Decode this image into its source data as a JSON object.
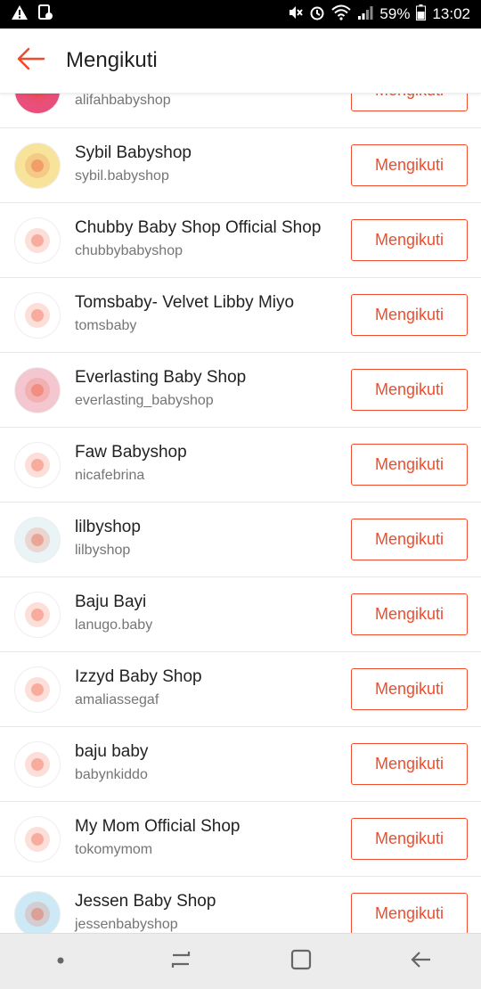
{
  "status_bar": {
    "battery": "59%",
    "time": "13:02",
    "icons": [
      "warning-icon",
      "screenshot-icon",
      "mute-icon",
      "alarm-icon",
      "wifi-icon",
      "signal-icon",
      "battery-icon"
    ]
  },
  "header": {
    "title": "Mengikuti",
    "back_icon": "arrow-left-icon"
  },
  "colors": {
    "accent": "#ee4d2d",
    "divider": "#e6e6e6",
    "subtext": "#757575"
  },
  "shops": [
    {
      "name": "",
      "username": "alifahbabyshop",
      "button": "Mengikuti",
      "avatar_color": "#e94f7b"
    },
    {
      "name": "Sybil Babyshop",
      "username": "sybil.babyshop",
      "button": "Mengikuti",
      "avatar_color": "#f7e49a"
    },
    {
      "name": "Chubby Baby Shop Official Shop",
      "username": "chubbybabyshop",
      "button": "Mengikuti",
      "avatar_color": "#ffffff"
    },
    {
      "name": "Tomsbaby- Velvet Libby Miyo",
      "username": "tomsbaby",
      "button": "Mengikuti",
      "avatar_color": "#ffffff"
    },
    {
      "name": "Everlasting Baby Shop",
      "username": "everlasting_babyshop",
      "button": "Mengikuti",
      "avatar_color": "#f4c6cf"
    },
    {
      "name": "Faw Babyshop",
      "username": "nicafebrina",
      "button": "Mengikuti",
      "avatar_color": "#ffffff"
    },
    {
      "name": "lilbyshop",
      "username": "lilbyshop",
      "button": "Mengikuti",
      "avatar_color": "#eaf3f5"
    },
    {
      "name": "Baju Bayi",
      "username": "lanugo.baby",
      "button": "Mengikuti",
      "avatar_color": "#ffffff"
    },
    {
      "name": "Izzyd Baby Shop",
      "username": "amaliassegaf",
      "button": "Mengikuti",
      "avatar_color": "#ffffff"
    },
    {
      "name": "baju baby",
      "username": "babynkiddo",
      "button": "Mengikuti",
      "avatar_color": "#ffffff"
    },
    {
      "name": "My Mom Official Shop",
      "username": "tokomymom",
      "button": "Mengikuti",
      "avatar_color": "#ffffff"
    },
    {
      "name": "Jessen Baby Shop",
      "username": "jessenbabyshop",
      "button": "Mengikuti",
      "avatar_color": "#cde9f6"
    }
  ],
  "nav": {
    "items": [
      "recent-dot-icon",
      "recents-icon",
      "home-icon",
      "back-icon"
    ]
  }
}
